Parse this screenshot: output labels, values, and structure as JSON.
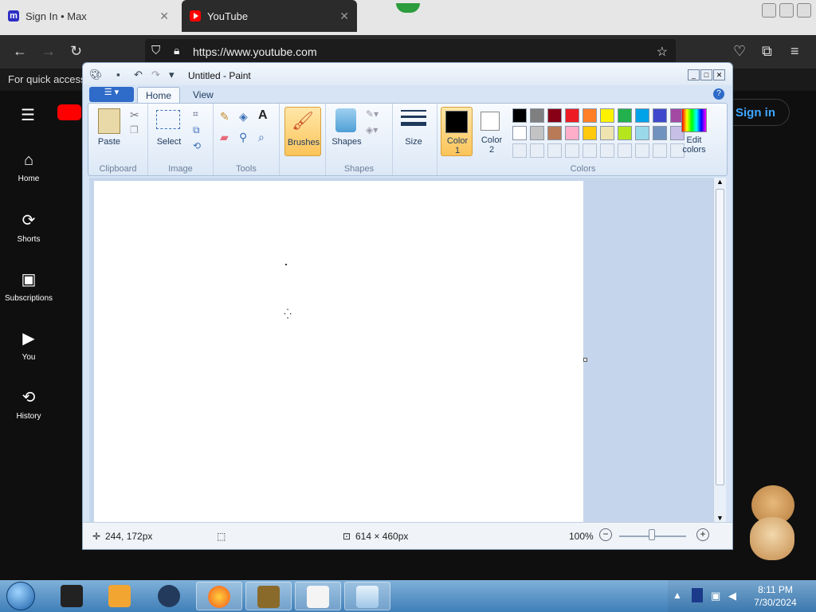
{
  "browser": {
    "tabs": [
      {
        "title": "Sign In • Max",
        "favicon": "m"
      },
      {
        "title": "YouTube"
      }
    ],
    "url": "https://www.youtube.com",
    "info_text": "For quick access,"
  },
  "youtube": {
    "nav": [
      {
        "label": "Home",
        "icon": "home-icon"
      },
      {
        "label": "Shorts",
        "icon": "shorts-icon"
      },
      {
        "label": "Subscriptions",
        "icon": "subscriptions-icon"
      },
      {
        "label": "You",
        "icon": "you-icon"
      },
      {
        "label": "History",
        "icon": "history-icon"
      }
    ],
    "signin_label": "Sign in"
  },
  "paint": {
    "title": "Untitled - Paint",
    "tabs": {
      "home": "Home",
      "view": "View"
    },
    "ribbon": {
      "paste": "Paste",
      "select": "Select",
      "brushes": "Brushes",
      "shapes": "Shapes",
      "size": "Size",
      "color1": "Color\n1",
      "color2": "Color\n2",
      "edit_colors": "Edit\ncolors",
      "groups": {
        "clipboard": "Clipboard",
        "image": "Image",
        "tools": "Tools",
        "shapes": "Shapes",
        "colors": "Colors"
      }
    },
    "palette_row1": [
      "#000000",
      "#7f7f7f",
      "#880015",
      "#ed1c24",
      "#ff7f27",
      "#fff200",
      "#22b14c",
      "#00a2e8",
      "#3f48cc",
      "#a349a4"
    ],
    "palette_row2": [
      "#ffffff",
      "#c3c3c3",
      "#b97a57",
      "#ffaec9",
      "#ffc90e",
      "#efe4b0",
      "#b5e61d",
      "#99d9ea",
      "#7092be",
      "#c8bfe7"
    ],
    "status": {
      "cursor": "244, 172px",
      "size": "614 × 460px",
      "zoom": "100%"
    }
  },
  "taskbar": {
    "time": "8:11 PM",
    "date": "7/30/2024"
  }
}
